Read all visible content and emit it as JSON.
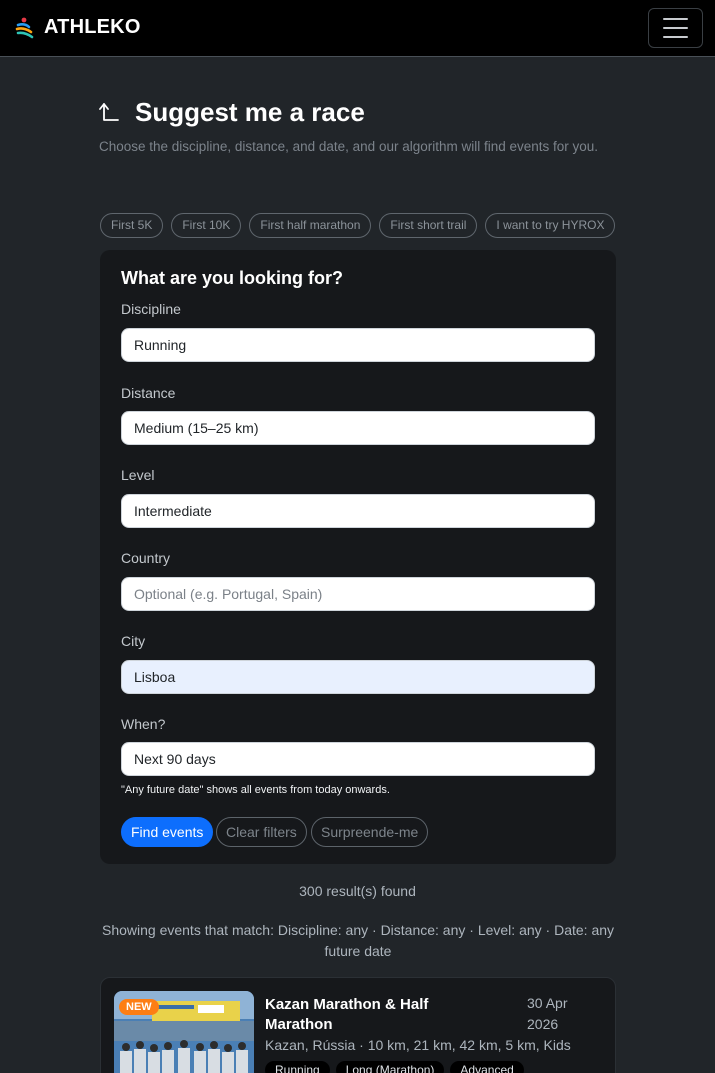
{
  "navbar": {
    "brand": "ATHLEKO",
    "logo_icon": "athleko-runner-logo",
    "menu_icon": "hamburger-menu-icon"
  },
  "header": {
    "title": "Suggest me a race",
    "subtitle": "Choose the discipline, distance, and date, and our algorithm will find events for you.",
    "icon": "turn-left-up-arrow-icon"
  },
  "quick_picks": [
    "First 5K",
    "First 10K",
    "First half marathon",
    "First short trail",
    "I want to try HYROX"
  ],
  "form": {
    "title": "What are you looking for?",
    "discipline": {
      "label": "Discipline",
      "value": "Running"
    },
    "distance": {
      "label": "Distance",
      "value": "Medium (15–25 km)"
    },
    "level": {
      "label": "Level",
      "value": "Intermediate"
    },
    "country": {
      "label": "Country",
      "value": "",
      "placeholder": "Optional (e.g. Portugal, Spain)"
    },
    "city": {
      "label": "City",
      "value": "Lisboa"
    },
    "when": {
      "label": "When?",
      "value": "Next 90 days"
    },
    "hint": "\"Any future date\" shows all events from today onwards.",
    "find_label": "Find events",
    "clear_label": "Clear filters",
    "surprise_label": "Surpreende-me"
  },
  "results": {
    "count_text": "300 result(s) found",
    "filters_text": "Showing events that match: Discipline: any · Distance: any · Level: any · Date: any future date"
  },
  "events": [
    {
      "badge": "NEW",
      "title": "Kazan Marathon & Half Marathon",
      "date": "30 Apr 2026",
      "location": "Kazan, Rússia · 10 km, 21 km, 42 km, 5 km, Kids",
      "tags": [
        "Running",
        "Long (Marathon)",
        "Advanced"
      ]
    }
  ],
  "colors": {
    "page_bg": "#212529",
    "navbar_bg": "#000000",
    "card_bg": "#16181b",
    "primary": "#0d6efd",
    "badge_new": "#fd7e14"
  }
}
